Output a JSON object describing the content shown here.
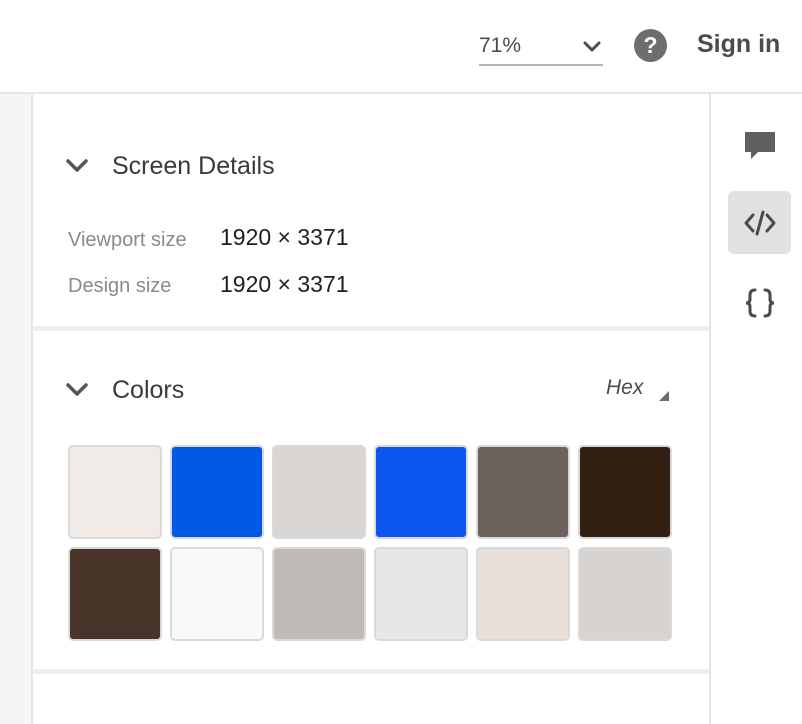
{
  "header": {
    "zoom": {
      "value": "71%"
    },
    "sign_in_label": "Sign in"
  },
  "screen_details": {
    "title": "Screen Details",
    "rows": [
      {
        "label": "Viewport size",
        "value": "1920 × 3371"
      },
      {
        "label": "Design size",
        "value": "1920 × 3371"
      }
    ]
  },
  "colors": {
    "title": "Colors",
    "format_label": "Hex",
    "swatches": [
      "#F0EBE7",
      "#0058E6",
      "#D8D5D3",
      "#0C55EE",
      "#6C615C",
      "#341F13",
      "#483428",
      "#FAF9F8",
      "#C0BBB7",
      "#E8E7E6",
      "#E8E0DA",
      "#D6D3D1"
    ]
  },
  "icons": {
    "zoom": "chevron-down-icon",
    "help": "help-icon",
    "comment": "comment-icon",
    "code": "code-icon",
    "braces": "braces-icon"
  }
}
